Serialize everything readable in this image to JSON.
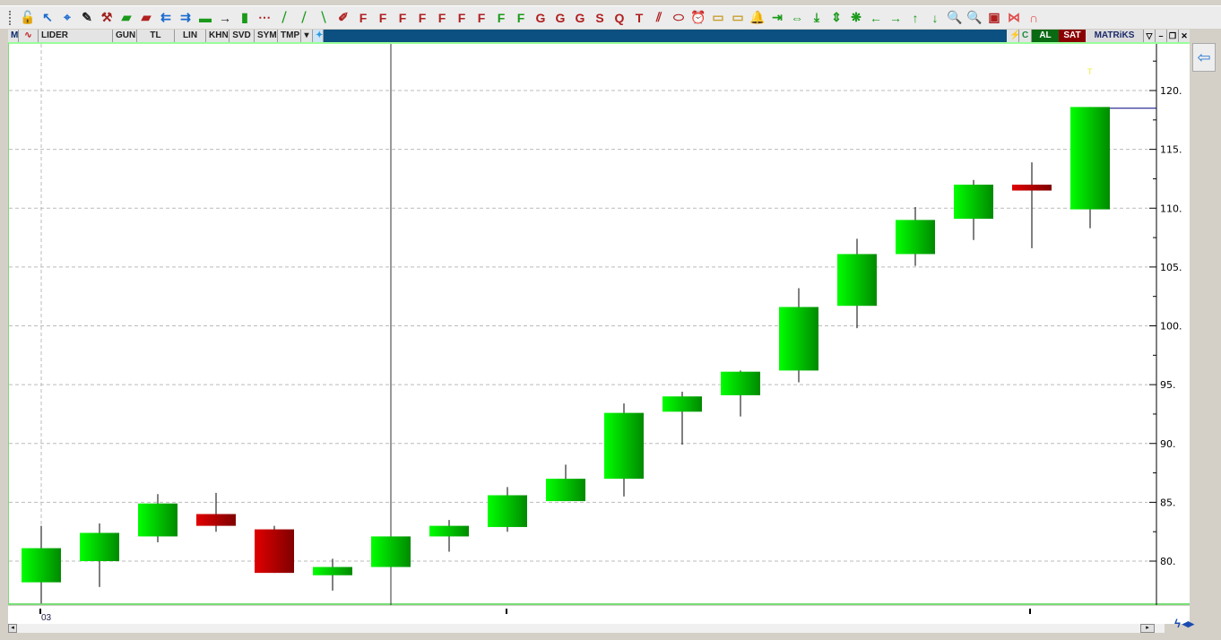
{
  "toolbar": {
    "icons": [
      {
        "name": "unlock-icon",
        "g": "🔓",
        "c": "#1a9a1a"
      },
      {
        "name": "pointer-arrow-icon",
        "g": "↖",
        "c": "#1a6ad0"
      },
      {
        "name": "crosshair-icon",
        "g": "⌖",
        "c": "#1a6ad0"
      },
      {
        "name": "edit-icon",
        "g": "✎",
        "c": "#222"
      },
      {
        "name": "tools-icon",
        "g": "⚒",
        "c": "#a02020"
      },
      {
        "name": "ruler-icon",
        "g": "▰",
        "c": "#1a9a1a"
      },
      {
        "name": "ruler-red-icon",
        "g": "▰",
        "c": "#b02020"
      },
      {
        "name": "arrow-left-lines-icon",
        "g": "⇇",
        "c": "#1a6ad0"
      },
      {
        "name": "arrow-right-lines-icon",
        "g": "⇉",
        "c": "#1a6ad0"
      },
      {
        "name": "horizontal-line-icon",
        "g": "▬",
        "c": "#1a9a1a"
      },
      {
        "name": "vision-arrow-icon",
        "g": "→",
        "c": "#222"
      },
      {
        "name": "vertical-line-icon",
        "g": "▮",
        "c": "#1a9a1a"
      },
      {
        "name": "segment-icon",
        "g": "⋯",
        "c": "#b02020"
      },
      {
        "name": "trend-line-icon",
        "g": "⧸",
        "c": "#1a9a1a"
      },
      {
        "name": "channel-icon",
        "g": "⧸",
        "c": "#1a9a1a"
      },
      {
        "name": "channel2-icon",
        "g": "⧹",
        "c": "#1a9a1a"
      },
      {
        "name": "pencil-icon",
        "g": "✐",
        "c": "#b02020"
      },
      {
        "name": "fib-retracement-icon",
        "g": "F",
        "c": "#b02020"
      },
      {
        "name": "fib-fan-icon",
        "g": "F",
        "c": "#b02020"
      },
      {
        "name": "fib-arc-icon",
        "g": "F",
        "c": "#b02020"
      },
      {
        "name": "fib-time-icon",
        "g": "F",
        "c": "#b02020"
      },
      {
        "name": "fib-ext-icon",
        "g": "F",
        "c": "#b02020"
      },
      {
        "name": "fib-grid-icon",
        "g": "F",
        "c": "#b02020"
      },
      {
        "name": "fib-projection-icon",
        "g": "F",
        "c": "#b02020"
      },
      {
        "name": "fib-channel-icon",
        "g": "F",
        "c": "#1a9a1a"
      },
      {
        "name": "fib-channel2-icon",
        "g": "F",
        "c": "#1a9a1a"
      },
      {
        "name": "gann-line-icon",
        "g": "G",
        "c": "#b02020"
      },
      {
        "name": "gann-fan-icon",
        "g": "G",
        "c": "#b02020"
      },
      {
        "name": "gann-box-icon",
        "g": "G",
        "c": "#b02020"
      },
      {
        "name": "speed-lines-icon",
        "g": "S",
        "c": "#b02020"
      },
      {
        "name": "quadrant-icon",
        "g": "Q",
        "c": "#b02020"
      },
      {
        "name": "tirone-icon",
        "g": "T",
        "c": "#b02020"
      },
      {
        "name": "parallel-lines-icon",
        "g": "⫽",
        "c": "#b02020"
      },
      {
        "name": "ellipse-icon",
        "g": "⬭",
        "c": "#b02020"
      },
      {
        "name": "alarm-clock-icon",
        "g": "⏰",
        "c": "#b02020"
      },
      {
        "name": "note-icon",
        "g": "▭",
        "c": "#c8a030"
      },
      {
        "name": "note-lines-icon",
        "g": "▭",
        "c": "#c8a030"
      },
      {
        "name": "bell-icon",
        "g": "🔔",
        "c": "#c8a030"
      },
      {
        "name": "compress-horizontal-icon",
        "g": "⇥",
        "c": "#1a9a1a"
      },
      {
        "name": "expand-horizontal-icon",
        "g": "⇔",
        "c": "#1a9a1a"
      },
      {
        "name": "compress-vertical-icon",
        "g": "⤓",
        "c": "#1a9a1a"
      },
      {
        "name": "expand-vertical-icon",
        "g": "⇕",
        "c": "#1a9a1a"
      },
      {
        "name": "reset-icon",
        "g": "❋",
        "c": "#1a9a1a"
      },
      {
        "name": "arrow-left-icon",
        "g": "←",
        "c": "#1a9a1a"
      },
      {
        "name": "arrow-right-icon",
        "g": "→",
        "c": "#1a9a1a"
      },
      {
        "name": "arrow-up-icon",
        "g": "↑",
        "c": "#1a9a1a"
      },
      {
        "name": "arrow-down-icon",
        "g": "↓",
        "c": "#1a9a1a"
      },
      {
        "name": "zoom-in-icon",
        "g": "🔍",
        "c": "#b02020"
      },
      {
        "name": "zoom-out-icon",
        "g": "🔍",
        "c": "#b02020"
      },
      {
        "name": "chart-frame-icon",
        "g": "▣",
        "c": "#b02020"
      },
      {
        "name": "bowtie-icon",
        "g": "⋈",
        "c": "#e05050"
      },
      {
        "name": "magnet-icon",
        "g": "∩",
        "c": "#e05050"
      }
    ]
  },
  "symbar": {
    "m": "M",
    "symbol": "LIDER",
    "period": "GUN",
    "currency": "TL",
    "scale": "LIN",
    "khn": "KHN",
    "svd": "SVD",
    "sym": "SYM",
    "tmp": "TMP",
    "buy": "AL",
    "sell": "SAT",
    "brand": "MATRiKS"
  },
  "side": {
    "arrow": "⇦"
  },
  "xaxis": {
    "first_label": "03"
  },
  "chart_data": {
    "type": "candlestick",
    "symbol": "LIDER",
    "period": "GUN",
    "ylim": [
      76.5,
      123.5
    ],
    "yticks": [
      80,
      85,
      90,
      95,
      100,
      105,
      110,
      115,
      120
    ],
    "ytick_labels": [
      "80.",
      "85.",
      "90.",
      "95.",
      "100.",
      "105.",
      "110.",
      "115.",
      "120."
    ],
    "last_price": 118.5,
    "colors": {
      "up": "#00ee00",
      "down": "#c00000"
    },
    "candles": [
      {
        "o": 78.2,
        "h": 83.0,
        "l": 76.4,
        "c": 81.1
      },
      {
        "o": 80.0,
        "h": 83.2,
        "l": 77.8,
        "c": 82.4
      },
      {
        "o": 82.1,
        "h": 85.7,
        "l": 81.6,
        "c": 84.9
      },
      {
        "o": 84.0,
        "h": 85.8,
        "l": 82.5,
        "c": 83.0
      },
      {
        "o": 82.7,
        "h": 83.0,
        "l": 79.0,
        "c": 79.0
      },
      {
        "o": 78.8,
        "h": 80.2,
        "l": 77.5,
        "c": 79.5
      },
      {
        "o": 79.5,
        "h": 82.1,
        "l": 79.5,
        "c": 82.1
      },
      {
        "o": 82.1,
        "h": 83.5,
        "l": 80.8,
        "c": 83.0
      },
      {
        "o": 82.9,
        "h": 86.3,
        "l": 82.5,
        "c": 85.6
      },
      {
        "o": 85.1,
        "h": 88.2,
        "l": 85.1,
        "c": 87.0
      },
      {
        "o": 87.0,
        "h": 93.4,
        "l": 85.5,
        "c": 92.6
      },
      {
        "o": 92.7,
        "h": 94.4,
        "l": 89.9,
        "c": 94.0
      },
      {
        "o": 94.1,
        "h": 96.2,
        "l": 92.3,
        "c": 96.1
      },
      {
        "o": 96.2,
        "h": 103.2,
        "l": 95.2,
        "c": 101.6
      },
      {
        "o": 101.7,
        "h": 107.4,
        "l": 99.8,
        "c": 106.1
      },
      {
        "o": 106.1,
        "h": 110.1,
        "l": 105.1,
        "c": 109.0
      },
      {
        "o": 109.1,
        "h": 112.4,
        "l": 107.3,
        "c": 112.0
      },
      {
        "o": 112.0,
        "h": 113.9,
        "l": 106.6,
        "c": 111.5
      },
      {
        "o": 109.9,
        "h": 118.6,
        "l": 108.3,
        "c": 118.6
      }
    ]
  }
}
